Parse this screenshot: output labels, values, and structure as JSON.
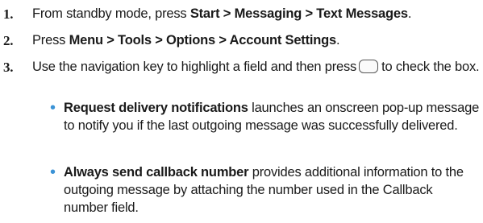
{
  "steps": [
    {
      "number": "1.",
      "pre": "From standby mode, press ",
      "bold": "Start > Messaging > Text Messages",
      "post": "."
    },
    {
      "number": "2.",
      "pre": "Press ",
      "bold": "Menu > Tools > Options > Account Settings",
      "post": "."
    },
    {
      "number": "3.",
      "pre": "Use the navigation key to highlight a field and then press",
      "post": "to check the box.",
      "key_icon": "center-key-icon"
    }
  ],
  "bullets": [
    {
      "bold": "Request delivery notifications",
      "text": " launches an onscreen pop-up message to notify you if the last outgoing message was successfully delivered."
    },
    {
      "bold": "Always send callback number",
      "text": " provides additional information to the outgoing message by attaching the number used in the Callback number field."
    }
  ],
  "colors": {
    "bullet": "#3b93d6",
    "text": "#1a1a1a"
  }
}
